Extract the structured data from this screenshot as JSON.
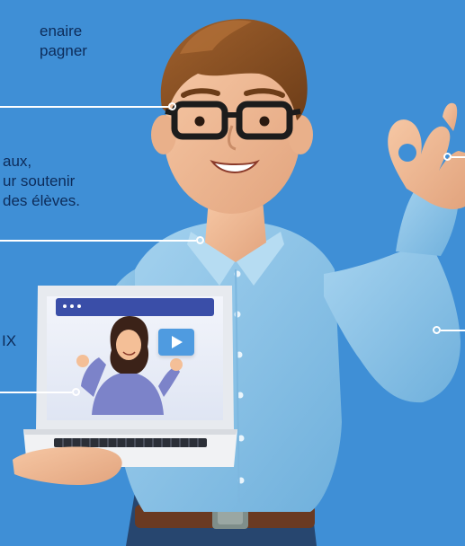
{
  "callouts": {
    "top": [
      "enaire",
      "pagner"
    ],
    "middle": [
      "aux,",
      "ur soutenir",
      "des élèves."
    ],
    "bottom": [
      "IX"
    ]
  },
  "icons": {
    "play": "play-icon",
    "window_dots": "window-dots-icon"
  },
  "colors": {
    "background": "#3f8fd6",
    "text": "#0d2c5a",
    "shirt": "#8cc3e6",
    "screen_bar": "#3a4ea8",
    "play_button": "#4f9be0",
    "connector": "#ffffff"
  }
}
